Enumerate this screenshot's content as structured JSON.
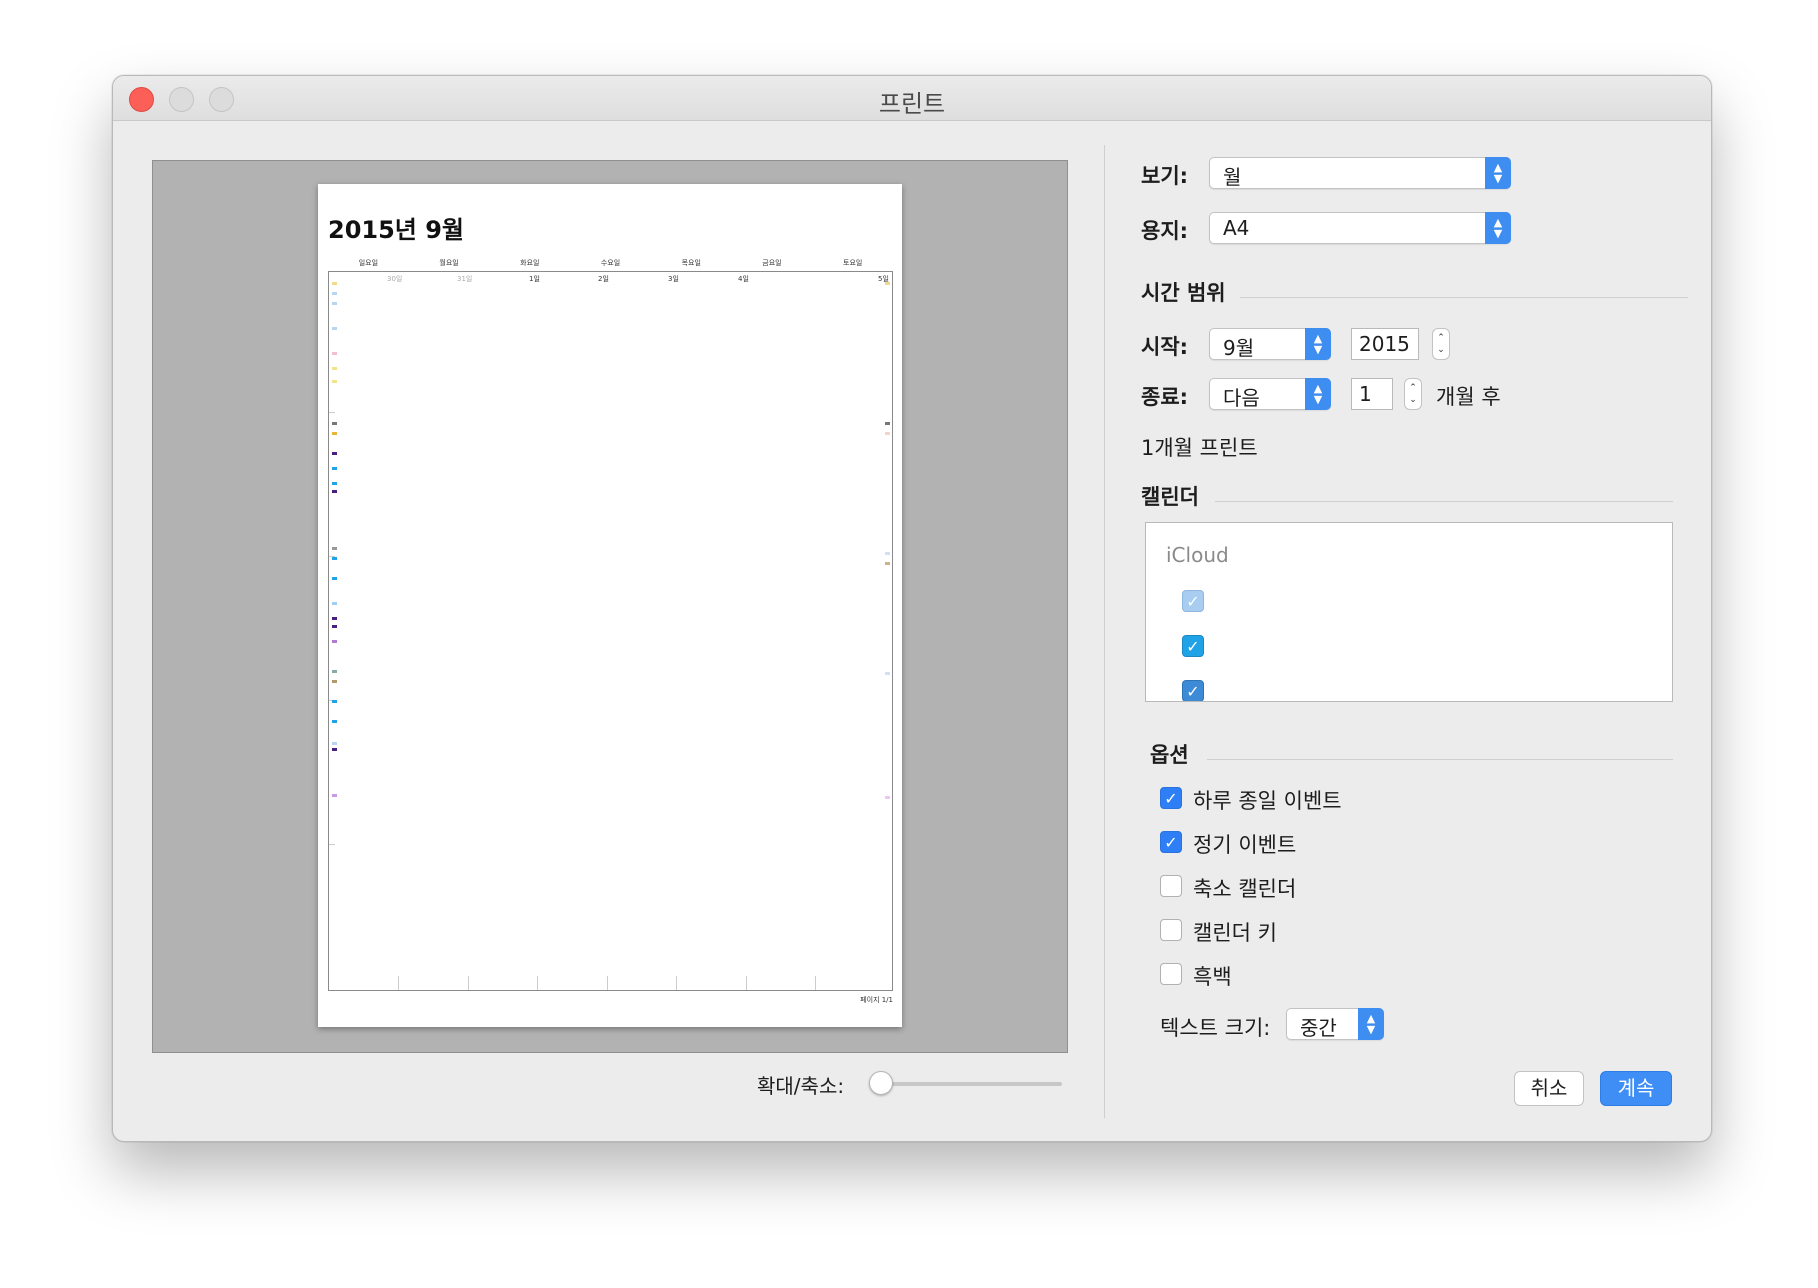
{
  "window": {
    "title": "프린트"
  },
  "preview": {
    "month_title": "2015년 9월",
    "weekdays": [
      "일요일",
      "월요일",
      "화요일",
      "수요일",
      "목요일",
      "금요일",
      "토요일"
    ],
    "dates_row1": [
      "30일",
      "31일",
      "1일",
      "2일",
      "3일",
      "4일",
      "5일"
    ],
    "page_label": "페이지 1/1",
    "zoom_label": "확대/축소:"
  },
  "view": {
    "label": "보기:",
    "value": "월"
  },
  "paper": {
    "label": "용지:",
    "value": "A4"
  },
  "time_range": {
    "heading": "시간 범위",
    "start_label": "시작:",
    "start_month": "9월",
    "start_year": "2015",
    "end_label": "종료:",
    "end_mode": "다음",
    "end_count": "1",
    "end_suffix": "개월 후",
    "summary": "1개월 프린트"
  },
  "calendars": {
    "heading": "캘린더",
    "group": "iCloud",
    "items": [
      {
        "checked": true,
        "color": "#a8cdf1"
      },
      {
        "checked": true,
        "color": "#1fa2e6"
      },
      {
        "checked": true,
        "color": "#3d8bd6"
      }
    ]
  },
  "options": {
    "heading": "옵션",
    "items": [
      {
        "label": "하루 종일 이벤트",
        "checked": true
      },
      {
        "label": "정기 이벤트",
        "checked": true
      },
      {
        "label": "축소 캘린더",
        "checked": false
      },
      {
        "label": "캘린더 키",
        "checked": false
      },
      {
        "label": "흑백",
        "checked": false
      }
    ],
    "text_size_label": "텍스트 크기:",
    "text_size_value": "중간"
  },
  "buttons": {
    "cancel": "취소",
    "continue": "계속"
  },
  "colors": {
    "accent": "#3e8ef5",
    "close": "#fc5f57"
  }
}
